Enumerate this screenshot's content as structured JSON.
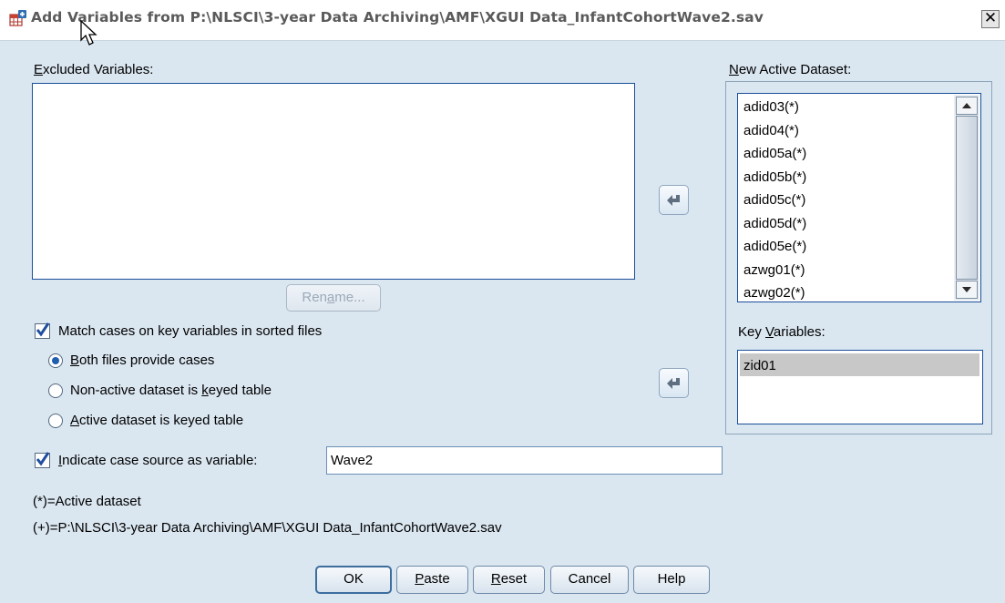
{
  "window": {
    "title": "Add Variables from P:\\NLSCI\\3-year Data Archiving\\AMF\\XGUI Data_InfantCohortWave2.sav",
    "close_glyph": "✕"
  },
  "excluded": {
    "label_pre": "",
    "label_u": "E",
    "label_post": "xcluded Variables:",
    "rename_pre": "Ren",
    "rename_u": "a",
    "rename_post": "me..."
  },
  "active_dataset": {
    "label_pre": "",
    "label_u": "N",
    "label_post": "ew Active Dataset:",
    "items": [
      "adid03(*)",
      "adid04(*)",
      "adid05a(*)",
      "adid05b(*)",
      "adid05c(*)",
      "adid05d(*)",
      "adid05e(*)",
      "azwg01(*)",
      "azwg02(*)"
    ]
  },
  "key_variables": {
    "label_pre": "Key ",
    "label_u": "V",
    "label_post": "ariables:",
    "items": [
      "zid01"
    ]
  },
  "match": {
    "checked": true,
    "label": "Match cases on key variables in sorted files",
    "options": [
      {
        "pre": "",
        "u": "B",
        "post": "oth files provide cases",
        "selected": true
      },
      {
        "pre": "Non-active dataset is ",
        "u": "k",
        "post": "eyed table",
        "selected": false
      },
      {
        "pre": "",
        "u": "A",
        "post": "ctive dataset is keyed table",
        "selected": false
      }
    ]
  },
  "case_source": {
    "checked": true,
    "label_pre": "",
    "label_u": "I",
    "label_post": "ndicate case source as variable:",
    "value": "Wave2"
  },
  "notes": {
    "active": "(*)=Active dataset",
    "other": "(+)=P:\\NLSCI\\3-year Data Archiving\\AMF\\XGUI Data_InfantCohortWave2.sav"
  },
  "buttons": {
    "ok": "OK",
    "paste_u": "P",
    "paste_post": "aste",
    "reset_u": "R",
    "reset_post": "eset",
    "cancel": "Cancel",
    "help": "Help"
  },
  "colors": {
    "dialog_bg": "#dae6f0",
    "selection": "#c8c8c8",
    "accent": "#1f5eb0"
  }
}
